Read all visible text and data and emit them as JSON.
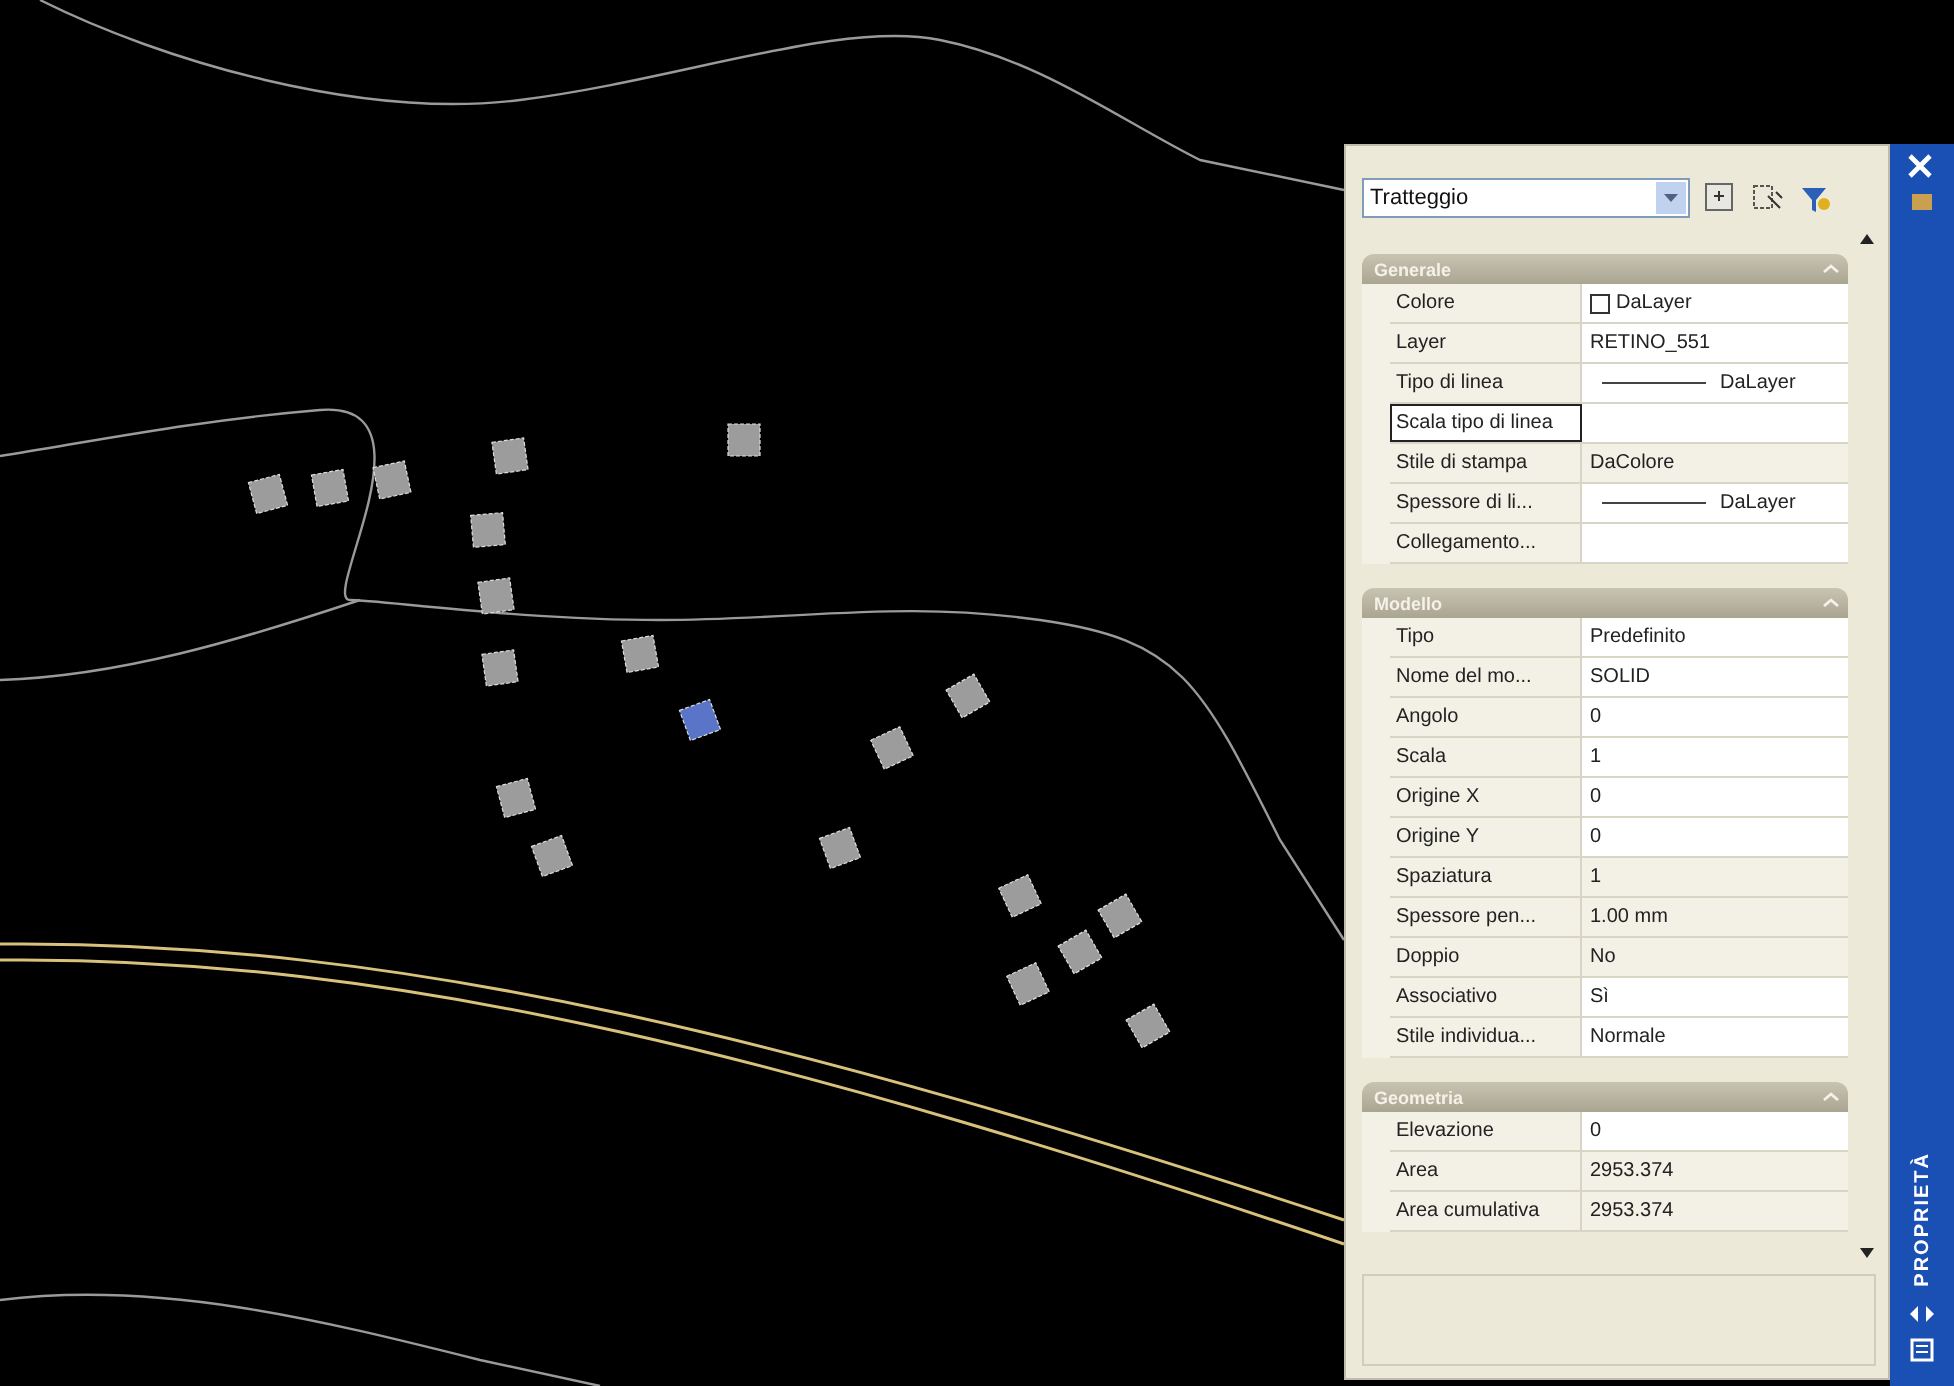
{
  "palette": {
    "object_type": "Tratteggio",
    "title": "PROPRIETÀ",
    "sections": [
      {
        "title": "Generale",
        "expanded": true,
        "rows": [
          {
            "label": "Colore",
            "value": "DaLayer",
            "kind": "swatch",
            "selected": false,
            "readonly": false
          },
          {
            "label": "Layer",
            "value": "RETINO_551",
            "kind": "text",
            "selected": false,
            "readonly": false
          },
          {
            "label": "Tipo di linea",
            "value": "DaLayer",
            "kind": "line",
            "selected": false,
            "readonly": false
          },
          {
            "label": "Scala tipo di linea",
            "value": "",
            "kind": "text",
            "selected": true,
            "readonly": false
          },
          {
            "label": "Stile di stampa",
            "value": "DaColore",
            "kind": "text",
            "selected": false,
            "readonly": true
          },
          {
            "label": "Spessore di li...",
            "value": "DaLayer",
            "kind": "line",
            "selected": false,
            "readonly": false
          },
          {
            "label": "Collegamento...",
            "value": "",
            "kind": "text",
            "selected": false,
            "readonly": false
          }
        ]
      },
      {
        "title": "Modello",
        "expanded": true,
        "rows": [
          {
            "label": "Tipo",
            "value": "Predefinito",
            "kind": "text",
            "selected": false,
            "readonly": false
          },
          {
            "label": "Nome del mo...",
            "value": "SOLID",
            "kind": "text",
            "selected": false,
            "readonly": false
          },
          {
            "label": "Angolo",
            "value": "0",
            "kind": "text",
            "selected": false,
            "readonly": false
          },
          {
            "label": "Scala",
            "value": "1",
            "kind": "text",
            "selected": false,
            "readonly": false
          },
          {
            "label": "Origine X",
            "value": "0",
            "kind": "text",
            "selected": false,
            "readonly": false
          },
          {
            "label": "Origine Y",
            "value": "0",
            "kind": "text",
            "selected": false,
            "readonly": false
          },
          {
            "label": "Spaziatura",
            "value": "1",
            "kind": "text",
            "selected": false,
            "readonly": true
          },
          {
            "label": "Spessore pen...",
            "value": "1.00 mm",
            "kind": "text",
            "selected": false,
            "readonly": true
          },
          {
            "label": "Doppio",
            "value": "No",
            "kind": "text",
            "selected": false,
            "readonly": true
          },
          {
            "label": "Associativo",
            "value": "Sì",
            "kind": "text",
            "selected": false,
            "readonly": false
          },
          {
            "label": "Stile individua...",
            "value": "Normale",
            "kind": "text",
            "selected": false,
            "readonly": false
          }
        ]
      },
      {
        "title": "Geometria",
        "expanded": true,
        "rows": [
          {
            "label": "Elevazione",
            "value": "0",
            "kind": "text",
            "selected": false,
            "readonly": false
          },
          {
            "label": "Area",
            "value": "2953.374",
            "kind": "text",
            "selected": false,
            "readonly": true
          },
          {
            "label": "Area cumulativa",
            "value": "2953.374",
            "kind": "text",
            "selected": false,
            "readonly": true
          }
        ]
      }
    ]
  }
}
